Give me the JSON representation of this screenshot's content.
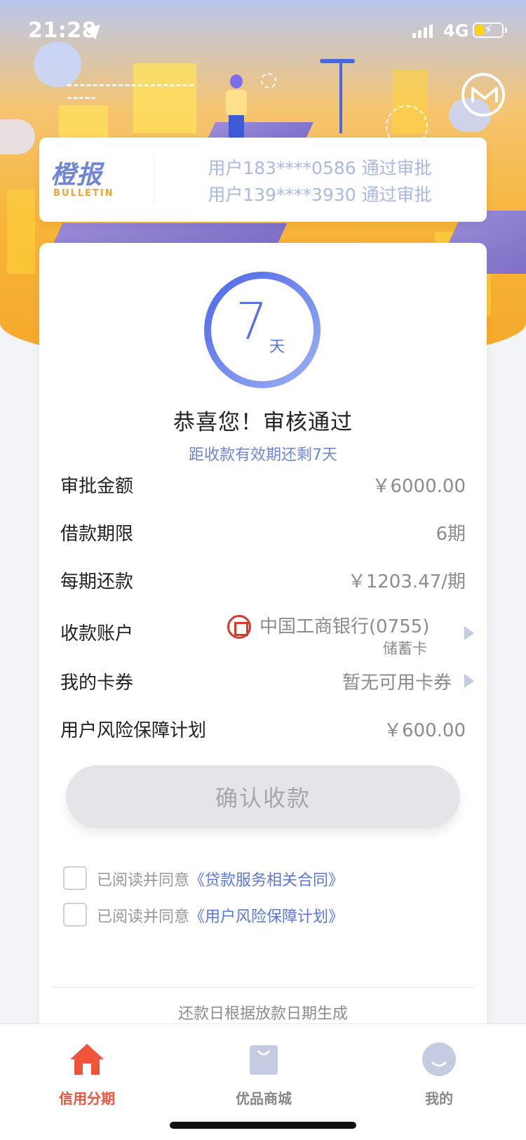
{
  "status_bar": {
    "time": "21:28",
    "network": "4G"
  },
  "bulletin": {
    "logo_cn": "橙报",
    "logo_en": "BULLETIN",
    "lines": [
      "用户183****0586 通过审批",
      "用户139****3930 通过审批"
    ]
  },
  "countdown": {
    "number": "7",
    "unit": "天"
  },
  "result": {
    "title": "恭喜您！审核通过",
    "subtitle": "距收款有效期还剩7天"
  },
  "details": {
    "approved_amount": {
      "label": "审批金额",
      "value": "￥6000.00"
    },
    "loan_term": {
      "label": "借款期限",
      "value": "6期"
    },
    "installment": {
      "label": "每期还款",
      "value": "￥1203.47/期"
    },
    "account": {
      "label": "收款账户",
      "bank": "中国工商银行(0755)",
      "card_type": "储蓄卡"
    },
    "coupons": {
      "label": "我的卡券",
      "value": "暂无可用卡券"
    },
    "risk_plan": {
      "label": "用户风险保障计划",
      "value": "￥600.00"
    }
  },
  "confirm_button": "确认收款",
  "agreements": [
    {
      "prefix": "已阅读并同意",
      "link": "《贷款服务相关合同》"
    },
    {
      "prefix": "已阅读并同意",
      "link": "《用户风险保障计划》"
    }
  ],
  "footnote": "还款日根据放款日期生成",
  "tabs": [
    {
      "label": "信用分期",
      "active": true
    },
    {
      "label": "优品商城",
      "active": false
    },
    {
      "label": "我的",
      "active": false
    }
  ],
  "colors": {
    "accent_blue": "#5571e6",
    "tab_active": "#f0553b",
    "hero_orange": "#f7b53a"
  }
}
